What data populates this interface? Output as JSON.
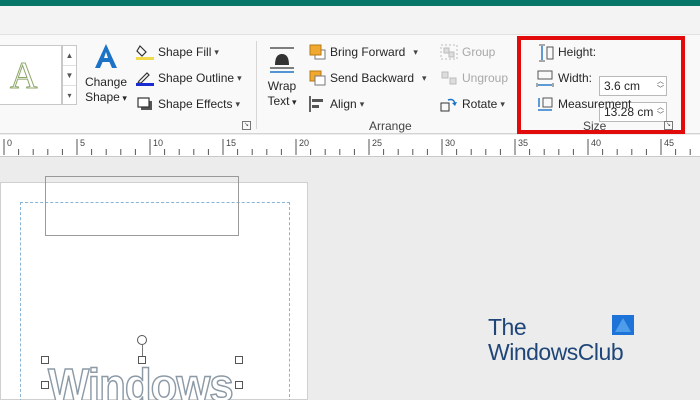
{
  "ribbon": {
    "shape_styles": {
      "change_shape_label_1": "Change",
      "change_shape_label_2": "Shape",
      "shape_fill": "Shape Fill",
      "shape_outline": "Shape Outline",
      "shape_effects": "Shape Effects"
    },
    "arrange": {
      "wrap_text_1": "Wrap",
      "wrap_text_2": "Text",
      "bring_forward": "Bring Forward",
      "send_backward": "Send Backward",
      "align": "Align",
      "group": "Group",
      "ungroup": "Ungroup",
      "rotate": "Rotate",
      "label": "Arrange"
    },
    "size": {
      "height_label": "Height:",
      "height_value": "3.6 cm",
      "width_label": "Width:",
      "width_value": "13.28 cm",
      "measurement": "Measurement",
      "label": "Size"
    }
  },
  "ruler": {
    "labels": [
      "0",
      "5",
      "10",
      "15",
      "20",
      "25",
      "30",
      "35",
      "40",
      "45"
    ]
  },
  "document": {
    "wordart_text": "Windows"
  },
  "watermark": {
    "line1": "The",
    "line2": "WindowsClub"
  },
  "colors": {
    "title_bar": "#077568",
    "highlight": "#e10b0b",
    "logo_text": "#1f4678",
    "logo_box": "#1e73d8"
  }
}
